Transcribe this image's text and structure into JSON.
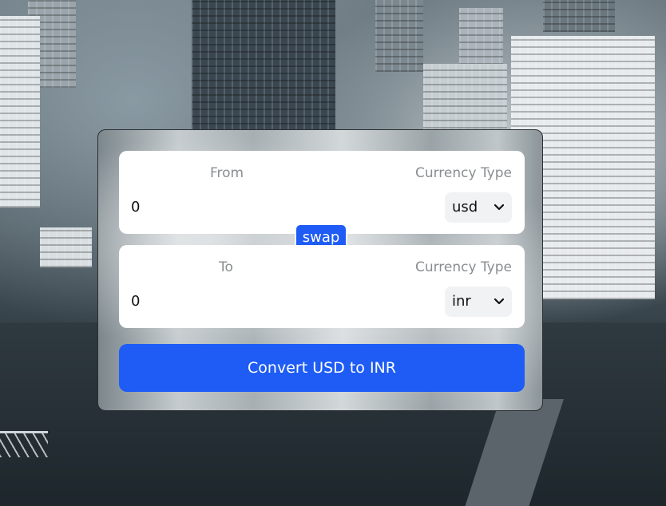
{
  "converter": {
    "from": {
      "label": "From",
      "amount": "0",
      "currency_label": "Currency Type",
      "currency": "usd"
    },
    "to": {
      "label": "To",
      "amount": "0",
      "currency_label": "Currency Type",
      "currency": "inr"
    },
    "swap_label": "swap",
    "convert_label": "Convert USD to INR"
  },
  "colors": {
    "accent": "#1e5cf5",
    "panel": "#ffffff",
    "label": "#8a8e91"
  },
  "icons": {
    "select_chevron": "chevron-down-icon"
  }
}
